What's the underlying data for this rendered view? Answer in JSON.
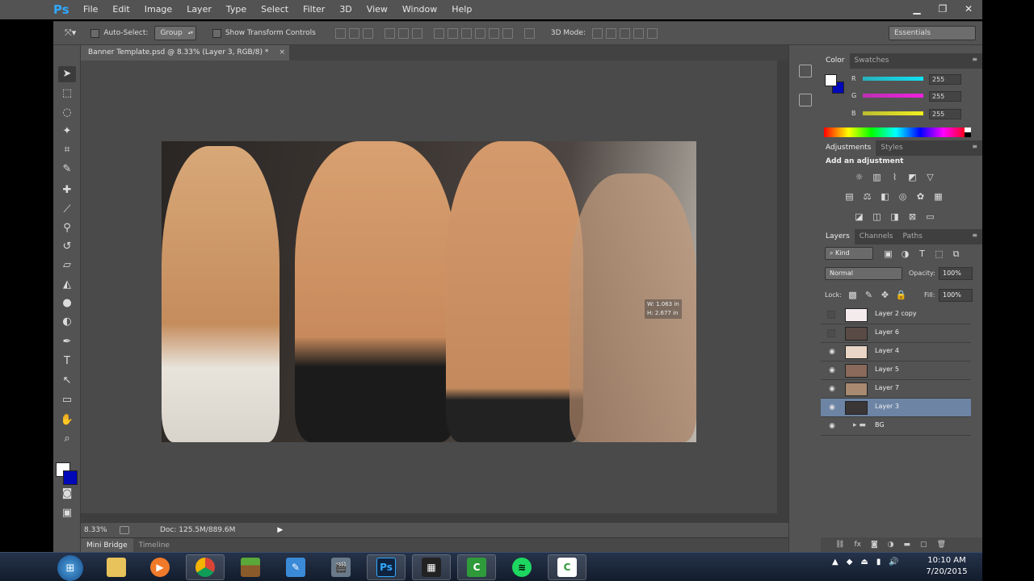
{
  "app": {
    "logo": "Ps",
    "menu": [
      "File",
      "Edit",
      "Image",
      "Layer",
      "Type",
      "Select",
      "Filter",
      "3D",
      "View",
      "Window",
      "Help"
    ]
  },
  "options_bar": {
    "auto_select_label": "Auto-Select:",
    "auto_select_value": "Group",
    "transform_label": "Show Transform Controls",
    "mode_3d_label": "3D Mode:",
    "workspace": "Essentials"
  },
  "document": {
    "tab_title": "Banner Template.psd @ 8.33% (Layer 3, RGB/8) *",
    "close_glyph": "×",
    "readout": [
      "W: 1.063 in",
      "H: 2.677 in"
    ],
    "zoom": "8.33%",
    "doc_info": "Doc: 125.5M/889.6M"
  },
  "bottom_tabs": [
    "Mini Bridge",
    "Timeline"
  ],
  "color_panel": {
    "tabs": [
      "Color",
      "Swatches"
    ],
    "channels": [
      {
        "label": "R",
        "value": "255",
        "gradient": "#11e0f0"
      },
      {
        "label": "G",
        "value": "255",
        "gradient": "#f020e0"
      },
      {
        "label": "B",
        "value": "255",
        "gradient": "#f0f020"
      }
    ],
    "foreground": "#ffffff",
    "background": "#0008b8"
  },
  "adjustments_panel": {
    "tabs": [
      "Adjustments",
      "Styles"
    ],
    "title": "Add an adjustment"
  },
  "layers_panel": {
    "tabs": [
      "Layers",
      "Channels",
      "Paths"
    ],
    "kind": "Kind",
    "blend_mode": "Normal",
    "opacity_label": "Opacity:",
    "opacity": "100%",
    "lock_label": "Lock:",
    "fill_label": "Fill:",
    "fill": "100%",
    "layers": [
      {
        "name": "Layer 2 copy",
        "visible": false,
        "thumb": "#f4ecec",
        "selected": false
      },
      {
        "name": "Layer 6",
        "visible": false,
        "thumb": "#5a4a46",
        "selected": false
      },
      {
        "name": "Layer 4",
        "visible": true,
        "thumb": "#e9d6c6",
        "selected": false
      },
      {
        "name": "Layer 5",
        "visible": true,
        "thumb": "#8a6a5a",
        "selected": false
      },
      {
        "name": "Layer 7",
        "visible": true,
        "thumb": "#a88a70",
        "selected": false
      },
      {
        "name": "Layer 3",
        "visible": true,
        "thumb": "#3a3636",
        "selected": true
      },
      {
        "name": "BG",
        "visible": true,
        "thumb": "",
        "selected": false,
        "group": true
      }
    ]
  },
  "taskbar": {
    "time": "10:10 AM",
    "date": "7/20/2015"
  }
}
